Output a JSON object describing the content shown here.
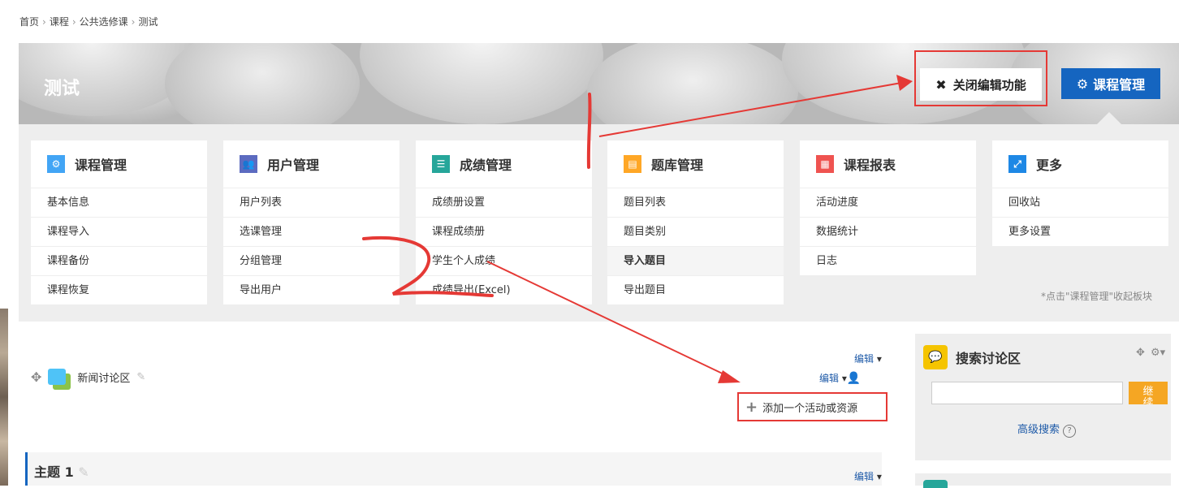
{
  "breadcrumb": [
    "首页",
    "课程",
    "公共选修课",
    "测试"
  ],
  "banner": {
    "title": "测试",
    "close_edit_label": "关闭编辑功能",
    "course_admin_label": "课程管理"
  },
  "cards": [
    {
      "title": "课程管理",
      "icon": "gear-icon",
      "color": "#42a5f5",
      "items": [
        {
          "label": "基本信息"
        },
        {
          "label": "课程导入"
        },
        {
          "label": "课程备份"
        },
        {
          "label": "课程恢复"
        }
      ]
    },
    {
      "title": "用户管理",
      "icon": "users-icon",
      "color": "#5c6bc0",
      "items": [
        {
          "label": "用户列表"
        },
        {
          "label": "选课管理"
        },
        {
          "label": "分组管理"
        },
        {
          "label": "导出用户"
        }
      ]
    },
    {
      "title": "成绩管理",
      "icon": "list-icon",
      "color": "#26a69a",
      "items": [
        {
          "label": "成绩册设置"
        },
        {
          "label": "课程成绩册"
        },
        {
          "label": "学生个人成绩"
        },
        {
          "label": "成绩导出(Excel)"
        }
      ]
    },
    {
      "title": "题库管理",
      "icon": "question-bank-icon",
      "color": "#ffa726",
      "items": [
        {
          "label": "题目列表"
        },
        {
          "label": "题目类别"
        },
        {
          "label": "导入题目",
          "bold": true
        },
        {
          "label": "导出题目"
        }
      ]
    },
    {
      "title": "课程报表",
      "icon": "table-icon",
      "color": "#ef5350",
      "items": [
        {
          "label": "活动进度"
        },
        {
          "label": "数据统计"
        },
        {
          "label": "日志"
        }
      ]
    },
    {
      "title": "更多",
      "icon": "expand-icon",
      "color": "#1e88e5",
      "items": [
        {
          "label": "回收站"
        },
        {
          "label": "更多设置"
        }
      ]
    }
  ],
  "collapse_note": "*点击\"课程管理\"收起板块",
  "main": {
    "edit_label": "编辑",
    "forum_label": "新闻讨论区",
    "add_activity_label": "添加一个活动或资源",
    "topic_title": "主题 1"
  },
  "sidebar": {
    "search_forum_title": "搜索讨论区",
    "search_button": "继续",
    "advanced_search": "高级搜索",
    "search_value": ""
  },
  "annotations": {
    "mark_1": "1",
    "mark_2": "2"
  }
}
